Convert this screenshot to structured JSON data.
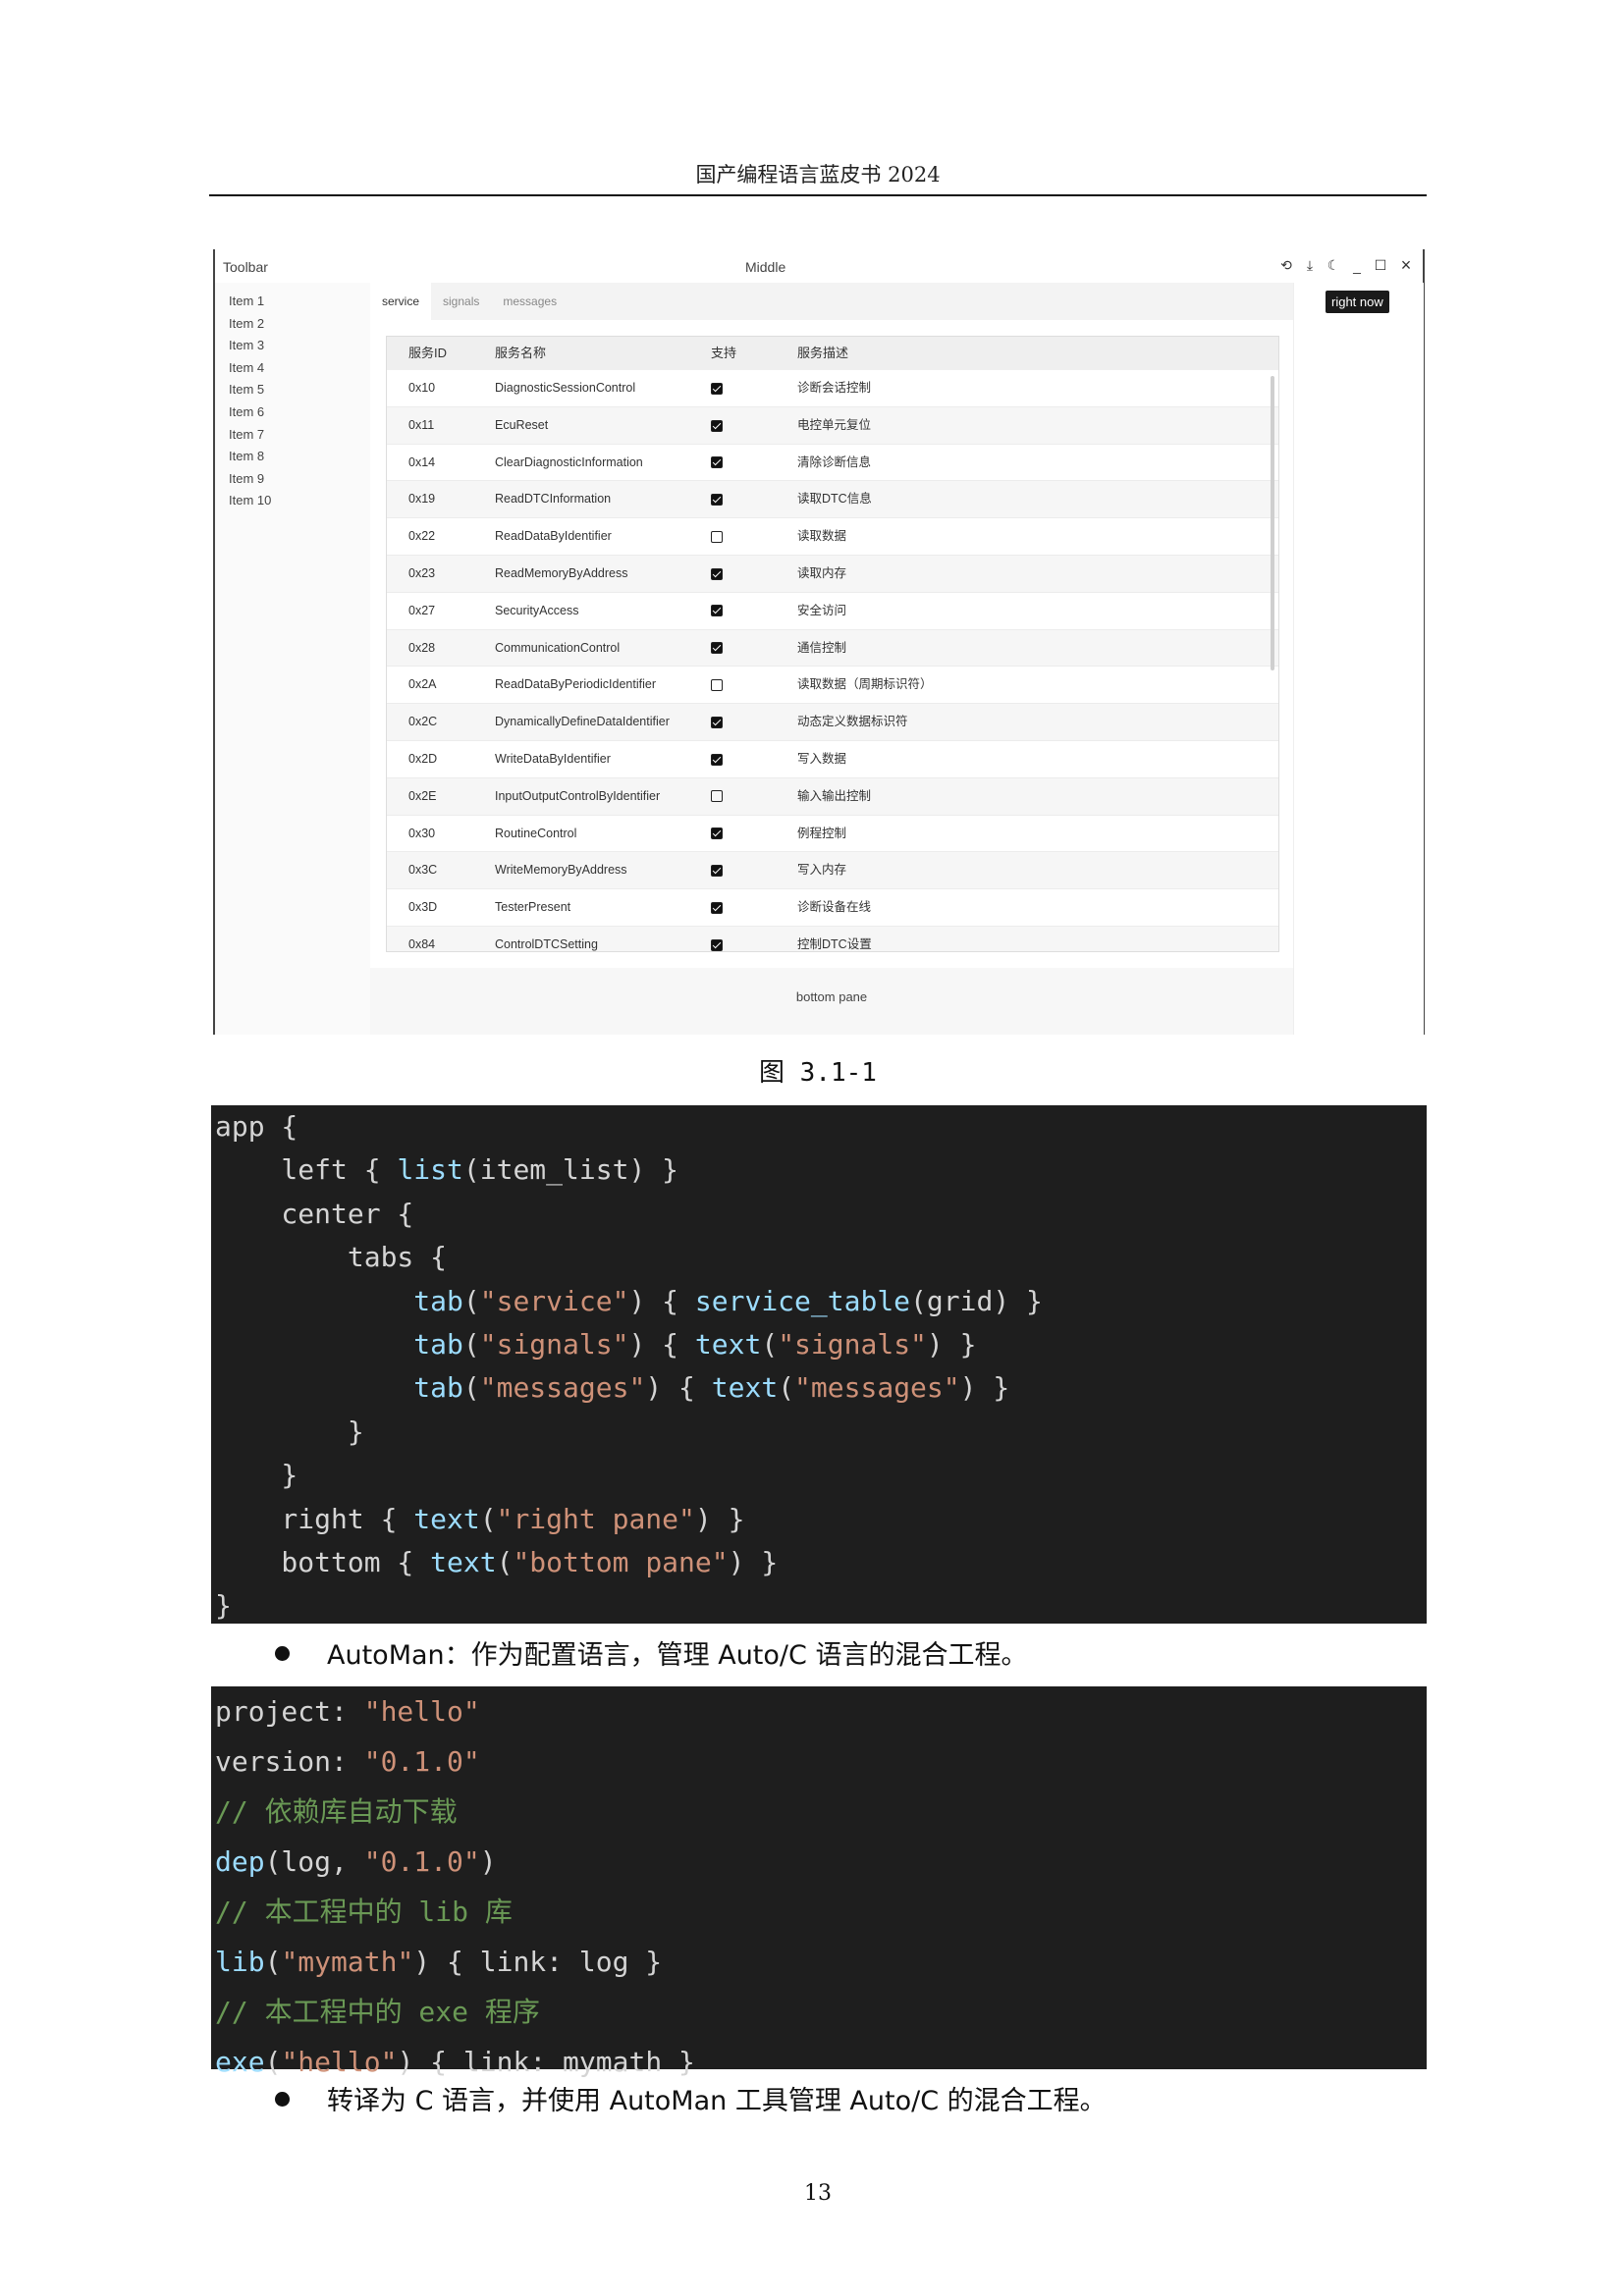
{
  "header": {
    "title": "国产编程语言蓝皮书 2024"
  },
  "app": {
    "toolbar_label": "Toolbar",
    "middle_label": "Middle",
    "left_items": [
      "Item 1",
      "Item 2",
      "Item 3",
      "Item 4",
      "Item 5",
      "Item 6",
      "Item 7",
      "Item 8",
      "Item 9",
      "Item 10"
    ],
    "tabs": [
      "service",
      "signals",
      "messages"
    ],
    "active_tab": "service",
    "table": {
      "headers": [
        "服务ID",
        "服务名称",
        "支持",
        "服务描述"
      ],
      "rows": [
        {
          "id": "0x10",
          "name": "DiagnosticSessionControl",
          "support": true,
          "desc": "诊断会话控制"
        },
        {
          "id": "0x11",
          "name": "EcuReset",
          "support": true,
          "desc": "电控单元复位"
        },
        {
          "id": "0x14",
          "name": "ClearDiagnosticInformation",
          "support": true,
          "desc": "清除诊断信息"
        },
        {
          "id": "0x19",
          "name": "ReadDTCInformation",
          "support": true,
          "desc": "读取DTC信息"
        },
        {
          "id": "0x22",
          "name": "ReadDataByIdentifier",
          "support": false,
          "desc": "读取数据"
        },
        {
          "id": "0x23",
          "name": "ReadMemoryByAddress",
          "support": true,
          "desc": "读取内存"
        },
        {
          "id": "0x27",
          "name": "SecurityAccess",
          "support": true,
          "desc": "安全访问"
        },
        {
          "id": "0x28",
          "name": "CommunicationControl",
          "support": true,
          "desc": "通信控制"
        },
        {
          "id": "0x2A",
          "name": "ReadDataByPeriodicIdentifier",
          "support": false,
          "desc": "读取数据（周期标识符）"
        },
        {
          "id": "0x2C",
          "name": "DynamicallyDefineDataIdentifier",
          "support": true,
          "desc": "动态定义数据标识符"
        },
        {
          "id": "0x2D",
          "name": "WriteDataByIdentifier",
          "support": true,
          "desc": "写入数据"
        },
        {
          "id": "0x2E",
          "name": "InputOutputControlByIdentifier",
          "support": false,
          "desc": "输入输出控制"
        },
        {
          "id": "0x30",
          "name": "RoutineControl",
          "support": true,
          "desc": "例程控制"
        },
        {
          "id": "0x3C",
          "name": "WriteMemoryByAddress",
          "support": true,
          "desc": "写入内存"
        },
        {
          "id": "0x3D",
          "name": "TesterPresent",
          "support": true,
          "desc": "诊断设备在线"
        },
        {
          "id": "0x84",
          "name": "ControlDTCSetting",
          "support": true,
          "desc": "控制DTC设置"
        }
      ]
    },
    "bottom_label": "bottom pane",
    "right_button": "right now"
  },
  "figure_caption": "图 3.1-1",
  "bullets": {
    "automan": "AutoMan：作为配置语言，管理 Auto/C 语言的混合工程。",
    "transpile": "转译为 C 语言，并使用 AutoMan 工具管理 Auto/C 的混合工程。"
  },
  "page_number": "13"
}
